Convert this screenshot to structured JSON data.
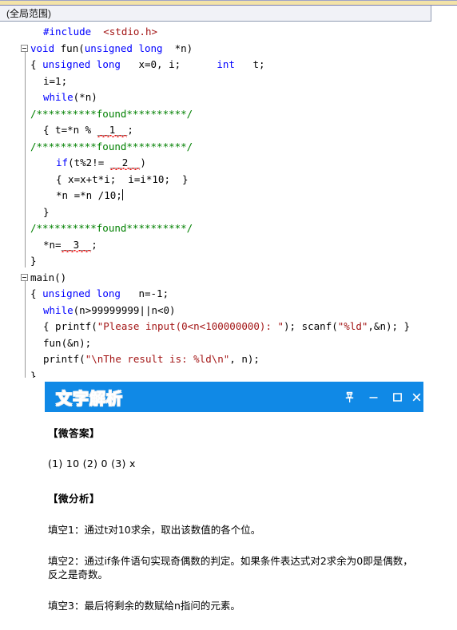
{
  "editor": {
    "scope_label": "(全局范围)",
    "cursor_line_index": 10,
    "code_lines": [
      {
        "indent": 1,
        "fold": false,
        "tokens": [
          {
            "t": "#include ",
            "c": "pp"
          },
          {
            "t": " <stdio.h>",
            "c": "str"
          }
        ]
      },
      {
        "indent": 0,
        "fold": true,
        "tokens": [
          {
            "t": "void ",
            "c": "kw"
          },
          {
            "t": "fun(",
            "c": "plain"
          },
          {
            "t": "unsigned long ",
            "c": "kw"
          },
          {
            "t": " *n)",
            "c": "plain"
          }
        ]
      },
      {
        "indent": 0,
        "fold": false,
        "tokens": [
          {
            "t": "{ ",
            "c": "plain"
          },
          {
            "t": "unsigned long ",
            "c": "kw"
          },
          {
            "t": "  x=0, i;      ",
            "c": "plain"
          },
          {
            "t": "int ",
            "c": "kw"
          },
          {
            "t": "  t;",
            "c": "plain"
          }
        ]
      },
      {
        "indent": 1,
        "fold": false,
        "tokens": [
          {
            "t": "i=1;",
            "c": "plain"
          }
        ]
      },
      {
        "indent": 1,
        "fold": false,
        "tokens": [
          {
            "t": "while",
            "c": "kw"
          },
          {
            "t": "(*n)",
            "c": "plain"
          }
        ]
      },
      {
        "indent": 0,
        "fold": false,
        "tokens": [
          {
            "t": "/**********found**********/",
            "c": "cmt"
          }
        ]
      },
      {
        "indent": 1,
        "fold": false,
        "tokens": [
          {
            "t": "{ t=*n % ",
            "c": "plain"
          },
          {
            "t": "__1__",
            "c": "blank"
          },
          {
            "t": ";",
            "c": "plain"
          }
        ]
      },
      {
        "indent": 0,
        "fold": false,
        "tokens": [
          {
            "t": "/**********found**********/",
            "c": "cmt"
          }
        ]
      },
      {
        "indent": 2,
        "fold": false,
        "tokens": [
          {
            "t": "if",
            "c": "kw"
          },
          {
            "t": "(t%2!= ",
            "c": "plain"
          },
          {
            "t": "__2__",
            "c": "blank"
          },
          {
            "t": ")",
            "c": "plain"
          }
        ]
      },
      {
        "indent": 2,
        "fold": false,
        "tokens": [
          {
            "t": "{ x=x+t*i;  i=i*10;  }",
            "c": "plain"
          }
        ]
      },
      {
        "indent": 2,
        "fold": false,
        "tokens": [
          {
            "t": "*n =*n /10;",
            "c": "plain"
          }
        ]
      },
      {
        "indent": 1,
        "fold": false,
        "tokens": [
          {
            "t": "}",
            "c": "plain"
          }
        ]
      },
      {
        "indent": 0,
        "fold": false,
        "tokens": [
          {
            "t": "/**********found**********/",
            "c": "cmt"
          }
        ]
      },
      {
        "indent": 1,
        "fold": false,
        "tokens": [
          {
            "t": "*n=",
            "c": "plain"
          },
          {
            "t": "__3__",
            "c": "blank"
          },
          {
            "t": ";",
            "c": "plain"
          }
        ]
      },
      {
        "indent": 0,
        "fold": false,
        "tokens": [
          {
            "t": "}",
            "c": "plain"
          }
        ]
      },
      {
        "indent": 0,
        "fold": true,
        "tokens": [
          {
            "t": "main()",
            "c": "plain"
          }
        ]
      },
      {
        "indent": 0,
        "fold": false,
        "tokens": [
          {
            "t": "{ ",
            "c": "plain"
          },
          {
            "t": "unsigned long ",
            "c": "kw"
          },
          {
            "t": "  n=-1;",
            "c": "plain"
          }
        ]
      },
      {
        "indent": 1,
        "fold": false,
        "tokens": [
          {
            "t": "while",
            "c": "kw"
          },
          {
            "t": "(n>99999999||n<0)",
            "c": "plain"
          }
        ]
      },
      {
        "indent": 1,
        "fold": false,
        "tokens": [
          {
            "t": "{ printf(",
            "c": "plain"
          },
          {
            "t": "\"Please input(0<n<100000000): \"",
            "c": "str"
          },
          {
            "t": "); scanf(",
            "c": "plain"
          },
          {
            "t": "\"%ld\"",
            "c": "str"
          },
          {
            "t": ",&n); }",
            "c": "plain"
          }
        ]
      },
      {
        "indent": 1,
        "fold": false,
        "tokens": [
          {
            "t": "fun(&n);",
            "c": "plain"
          }
        ]
      },
      {
        "indent": 1,
        "fold": false,
        "tokens": [
          {
            "t": "printf(",
            "c": "plain"
          },
          {
            "t": "\"\\nThe result is: %ld\\n\"",
            "c": "str"
          },
          {
            "t": ", n);",
            "c": "plain"
          }
        ]
      },
      {
        "indent": 0,
        "fold": false,
        "tokens": [
          {
            "t": "}",
            "c": "plain"
          }
        ]
      }
    ]
  },
  "explain_panel": {
    "title": "文字解析",
    "accent_color": "#1089e6",
    "window_buttons": [
      {
        "name": "pin-icon",
        "label": ""
      },
      {
        "name": "minimize-icon",
        "label": ""
      },
      {
        "name": "maximize-icon",
        "label": ""
      },
      {
        "name": "close-icon",
        "label": ""
      }
    ],
    "answer_heading": "【微答案】",
    "answer_text": "(1) 10 (2) 0 (3) x",
    "analysis_heading": "【微分析】",
    "analysis_items": [
      "填空1：通过t对10求余，取出该数值的各个位。",
      "填空2：通过if条件语句实现奇偶数的判定。如果条件表达式对2求余为0即是偶数，反之是奇数。",
      "填空3：最后将剩余的数赋给n指问的元素。"
    ]
  }
}
